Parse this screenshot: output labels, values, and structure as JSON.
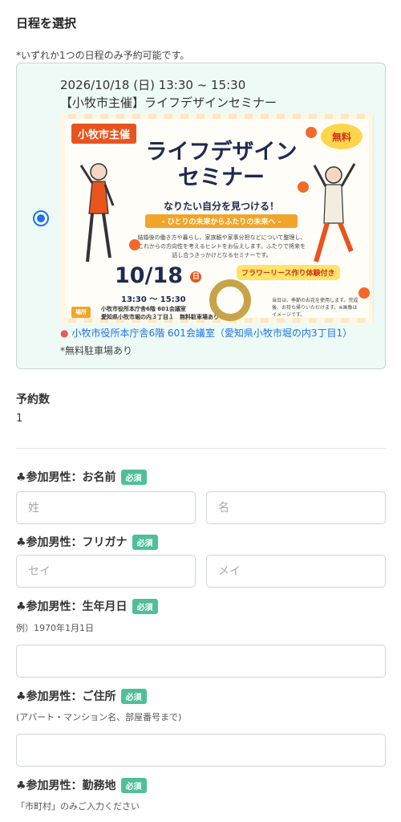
{
  "schedule": {
    "heading": "日程を選択",
    "note": "*いずれか1つの日程のみ予約可能です。",
    "option": {
      "datetime": "2026/10/18 (日) 13:30 ~ 15:30",
      "title": "【小牧市主催】ライフデザインセミナー",
      "location": "小牧市役所本庁舎6階 601会議室（愛知県小牧市堀の内3丁目1）",
      "parking": "*無料駐車場あり",
      "selected": true
    },
    "banner": {
      "host_tag": "小牧市主催",
      "free_badge": "無料",
      "headline_1": "ライフデザイン",
      "headline_2": "セミナー",
      "tagline": "なりたい自分を見つける！",
      "subtagline": "- ひとりの未来からふたりの未来へ -",
      "description": "結婚後の働き方や暮らし、家族観や家事分担などについて整理し、これからの方向性を考えるヒントをお伝えします。ふたりで将来を話し合うきっかけとなるセミナーです。",
      "date": "10/18",
      "day": "日",
      "time": "13:30 ～ 15:30",
      "place_label": "場所",
      "place_line1": "小牧市役所本庁舎6階 601会議室",
      "place_line2": "愛知県小牧市堀の内３丁目１　無料駐車場あり",
      "workshop": "フラワーリース作り体験付き",
      "workshop_note": "当日は、季節のお花を使用します。完成後、お持ち帰りいただけます。※画像はイメージです。"
    }
  },
  "quantity": {
    "label": "予約数",
    "value": "1"
  },
  "form": {
    "required_badge": "必須",
    "name": {
      "label": "♣参加男性：お名前",
      "last_placeholder": "姓",
      "first_placeholder": "名"
    },
    "kana": {
      "label": "♣参加男性：フリガナ",
      "last_placeholder": "セイ",
      "first_placeholder": "メイ"
    },
    "birthdate": {
      "label": "♣参加男性：生年月日",
      "hint": "例）1970年1月1日"
    },
    "address": {
      "label": "♣参加男性：ご住所",
      "hint": "(アパート・マンション名、部屋番号まで)"
    },
    "workplace": {
      "label": "♣参加男性：勤務地",
      "hint": "「市町村」のみご入力ください"
    }
  },
  "colors": {
    "accent": "#1a73e8",
    "required": "#4fbf9a",
    "card_bg": "#eefaf6",
    "banner_orange": "#e8541e"
  }
}
